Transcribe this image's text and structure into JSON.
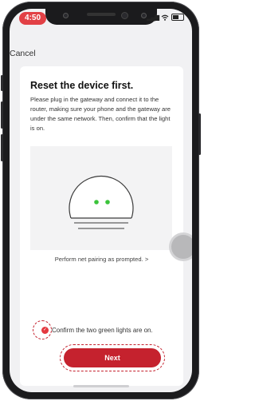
{
  "status_bar": {
    "time": "4:50"
  },
  "nav": {
    "cancel_label": "Cancel"
  },
  "card": {
    "title": "Reset the device first.",
    "description": "Please plug in the gateway and connect it to the router, making sure your phone and the gateway are under the same network. Then, confirm that the light is on.",
    "pairing_link": "Perform net pairing as prompted. >",
    "confirm_label": "Confirm the two green lights are on.",
    "confirm_checked": true,
    "next_label": "Next"
  },
  "colors": {
    "accent": "#c5222e",
    "status_pill": "#e24045",
    "led": "#3bc43b"
  },
  "icons": {
    "check": "check-icon",
    "device": "gateway-device-illustration"
  }
}
